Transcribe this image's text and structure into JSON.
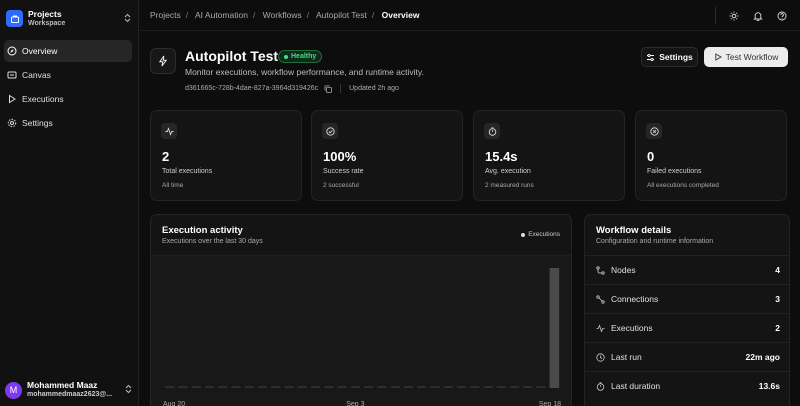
{
  "sidebar": {
    "workspace": {
      "name": "Projects",
      "sub": "Workspace"
    },
    "items": [
      {
        "label": "Overview",
        "icon": "compass-icon",
        "active": true
      },
      {
        "label": "Canvas",
        "icon": "canvas-icon",
        "active": false
      },
      {
        "label": "Executions",
        "icon": "play-icon",
        "active": false
      },
      {
        "label": "Settings",
        "icon": "gear-icon",
        "active": false
      }
    ],
    "user": {
      "initial": "M",
      "name": "Mohammed Maaz",
      "email": "mohammedmaaz2623@..."
    }
  },
  "breadcrumb": [
    "Projects",
    "AI Automation",
    "Workflows",
    "Autopilot Test",
    "Overview"
  ],
  "header": {
    "title": "Autopilot Test",
    "badge": "Healthy",
    "subtitle": "Monitor executions, workflow performance, and runtime activity.",
    "id": "d361665c-728b-4dae-827a-3964d319426c",
    "updated": "Updated 2h ago",
    "settings_label": "Settings",
    "test_label": "Test Workflow"
  },
  "stats": [
    {
      "value": "2",
      "label": "Total executions",
      "sub": "All time",
      "icon": "activity-icon"
    },
    {
      "value": "100%",
      "label": "Success rate",
      "sub": "2 successful",
      "icon": "check-circle-icon"
    },
    {
      "value": "15.4s",
      "label": "Avg. execution",
      "sub": "2 measured runs",
      "icon": "timer-icon"
    },
    {
      "value": "0",
      "label": "Failed executions",
      "sub": "All executions completed",
      "icon": "x-circle-icon"
    }
  ],
  "activity": {
    "title": "Execution activity",
    "subtitle": "Executions over the last 30 days",
    "legend": "Executions"
  },
  "chart_data": {
    "type": "bar",
    "title": "Execution activity",
    "x_tick_labels": [
      "Aug 20",
      "Sep 3",
      "Sep 18"
    ],
    "categories": [
      "Aug 20",
      "Aug 21",
      "Aug 22",
      "Aug 23",
      "Aug 24",
      "Aug 25",
      "Aug 26",
      "Aug 27",
      "Aug 28",
      "Aug 29",
      "Aug 30",
      "Aug 31",
      "Sep 1",
      "Sep 2",
      "Sep 3",
      "Sep 4",
      "Sep 5",
      "Sep 6",
      "Sep 7",
      "Sep 8",
      "Sep 9",
      "Sep 10",
      "Sep 11",
      "Sep 12",
      "Sep 13",
      "Sep 14",
      "Sep 15",
      "Sep 16",
      "Sep 17",
      "Sep 18"
    ],
    "series": [
      {
        "name": "Executions",
        "values": [
          0,
          0,
          0,
          0,
          0,
          0,
          0,
          0,
          0,
          0,
          0,
          0,
          0,
          0,
          0,
          0,
          0,
          0,
          0,
          0,
          0,
          0,
          0,
          0,
          0,
          0,
          0,
          0,
          0,
          2
        ]
      }
    ],
    "ylim": [
      0,
      2
    ],
    "grid": false,
    "legend_position": "top-right",
    "bar_color": "#4a4a4a",
    "baseline_color": "#2e2e2e"
  },
  "details": {
    "title": "Workflow details",
    "subtitle": "Configuration and runtime information",
    "rows": [
      {
        "label": "Nodes",
        "value": "4",
        "icon": "nodes-icon"
      },
      {
        "label": "Connections",
        "value": "3",
        "icon": "connections-icon"
      },
      {
        "label": "Executions",
        "value": "2",
        "icon": "activity-icon"
      },
      {
        "label": "Last run",
        "value": "22m ago",
        "icon": "clock-icon"
      },
      {
        "label": "Last duration",
        "value": "13.6s",
        "icon": "timer-icon"
      }
    ]
  },
  "colors": {
    "accent": "#2f6bff",
    "healthy": "#4ade80",
    "avatar": "#7e3af2"
  }
}
